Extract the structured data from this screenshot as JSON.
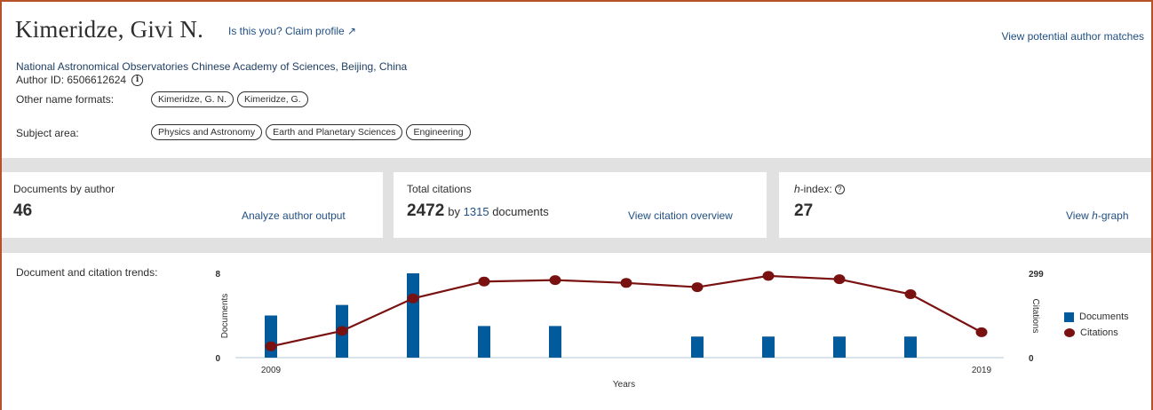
{
  "header": {
    "author_name": "Kimeridze, Givi N.",
    "claim_link": "Is this you? Claim profile ↗",
    "potential_matches_link": "View potential author matches",
    "affiliation": "National Astronomical Observatories Chinese Academy of Sciences, Beijing, China",
    "author_id": "Author ID: 6506612624",
    "other_name_formats_label": "Other name formats:",
    "other_name_formats": [
      "Kimeridze, G. N.",
      "Kimeridze, G."
    ],
    "subject_area_label": "Subject area:",
    "subject_areas": [
      "Physics and Astronomy",
      "Earth and Planetary Sciences",
      "Engineering"
    ]
  },
  "stats": {
    "documents": {
      "label": "Documents by author",
      "value": "46",
      "link": "Analyze author output"
    },
    "citations": {
      "label": "Total citations",
      "value": "2472",
      "by_text": "by",
      "documents_count": "1315",
      "documents_text": "documents",
      "link": "View citation overview"
    },
    "hindex": {
      "label_italic": "h",
      "label_rest": "-index:",
      "value": "27",
      "link_prefix": "View ",
      "link_italic": "h",
      "link_suffix": "-graph"
    }
  },
  "trends": {
    "label": "Document and citation trends:",
    "legend": {
      "documents": "Documents",
      "citations": "Citations"
    }
  },
  "colors": {
    "bar": "#005a9c",
    "line": "#7a1111",
    "link": "#1f4f82",
    "border": "#b5522a"
  },
  "chart_data": {
    "type": "bar",
    "x": [
      2009,
      2010,
      2011,
      2012,
      2013,
      2014,
      2015,
      2016,
      2017,
      2018,
      2019
    ],
    "x_tick_labels": [
      "2009",
      "2019"
    ],
    "xlabel": "Years",
    "series": [
      {
        "name": "Documents",
        "type": "bar",
        "axis": "left",
        "values": [
          4,
          5,
          8,
          3,
          3,
          0,
          2,
          2,
          2,
          2,
          0
        ]
      },
      {
        "name": "Citations",
        "type": "line",
        "axis": "right",
        "values": [
          40,
          95,
          210,
          270,
          275,
          265,
          250,
          290,
          278,
          225,
          90
        ]
      }
    ],
    "ylabel_left": "Documents",
    "ylabel_right": "Citations",
    "ylim_left": [
      0,
      8
    ],
    "ylim_right": [
      0,
      299
    ],
    "left_ticks": [
      "0",
      "8"
    ],
    "right_ticks": [
      "0",
      "299"
    ],
    "legend": "right"
  }
}
